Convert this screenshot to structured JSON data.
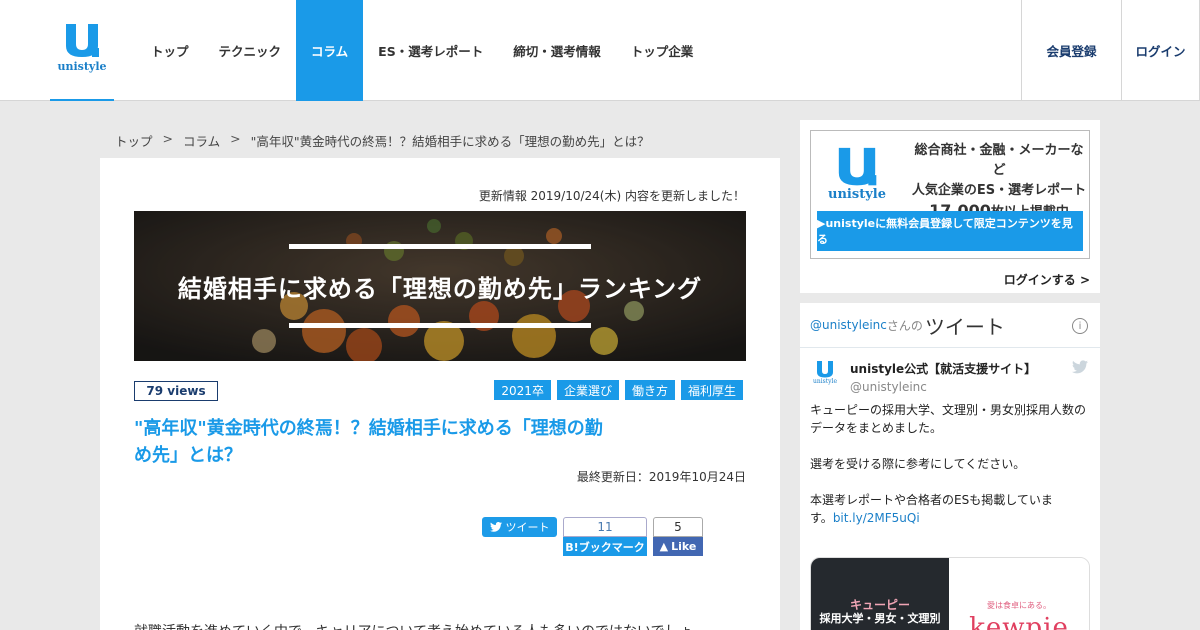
{
  "header": {
    "logo_text": "unistyle",
    "nav": [
      "トップ",
      "テクニック",
      "コラム",
      "ES・選考レポート",
      "締切・選考情報",
      "トップ企業"
    ],
    "active_nav": "コラム",
    "signup": "会員登録",
    "login": "ログイン"
  },
  "breadcrumb": {
    "items": [
      "トップ",
      "コラム",
      "\"高年収\"黄金時代の終焉！？結婚相手に求める「理想の勤め先」とは？"
    ],
    "separator": ">"
  },
  "article": {
    "update_info": "更新情報 2019/10/24(木) 内容を更新しました！",
    "hero_title": "結婚相手に求める「理想の勤め先」ランキング",
    "views": "79 views",
    "tags": [
      "2021卒",
      "企業選び",
      "働き方",
      "福利厚生"
    ],
    "title": "\"高年収\"黄金時代の終焉！？結婚相手に求める「理想の勤め先」とは？",
    "last_updated": "最終更新日：2019年10月24日",
    "share": {
      "tweet": "ツイート",
      "hatena_count": "11",
      "hatena_label": "B!ブックマーク",
      "fb_count": "5",
      "fb_label": "Like"
    },
    "body_start": "就職活動を進めていく中で、キャリアについて考え始めている人も多いのではないでしょ"
  },
  "sidebar": {
    "promo": {
      "logo_text": "unistyle",
      "line1": "総合商社・金融・メーカーなど",
      "line2": "人気企業のES・選考レポート",
      "count": "17,000",
      "count_suffix": "枚以上掲載中",
      "cta": "▶unistyleに無料会員登録して限定コンテンツを見る",
      "login_link": "ログインする >"
    },
    "twitter": {
      "handle": "@unistyleinc",
      "san": "さんの",
      "title": "ツイート",
      "user_name": "unistyle公式【就活支援サイト】",
      "user_handle": "@unistyleinc",
      "tweet_line1": "キューピーの採用大学、文理別・男女別採用人数の",
      "tweet_line2": "データをまとめました。",
      "tweet_line3": "選考を受ける際に参考にしてください。",
      "tweet_line4": "本選考レポートや合格者のESも掲載していま",
      "tweet_line5": "す。",
      "tweet_link": "bit.ly/2MF5uQi",
      "media_left_1": "キューピー",
      "media_left_2": "採用大学・男女・文理別",
      "media_right_small": "愛は食卓にある。",
      "media_right_brand": "kewpie"
    }
  },
  "colors": {
    "accent": "#1a9ae8",
    "navy": "#1a3c6e",
    "facebook": "#4267b2"
  }
}
